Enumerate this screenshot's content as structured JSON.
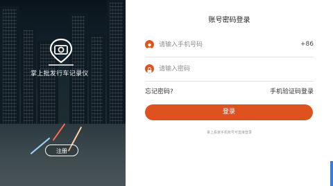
{
  "brand": {
    "app_name": "掌上批发行车记录仪",
    "register_label": "注册"
  },
  "login": {
    "title": "账号密码登录",
    "phone_placeholder": "请输入手机号码",
    "country_code": "+86",
    "password_placeholder": "请输入密码",
    "forgot_label": "忘记密码?",
    "sms_login_label": "手机验证码登录",
    "submit_label": "登录",
    "hint_text": "掌上看家手机账号可直接登录"
  },
  "colors": {
    "accent": "#de5220"
  },
  "icons": {
    "logo": "camera-pin-icon",
    "phone_field": "user-icon",
    "password_field": "lock-icon"
  }
}
